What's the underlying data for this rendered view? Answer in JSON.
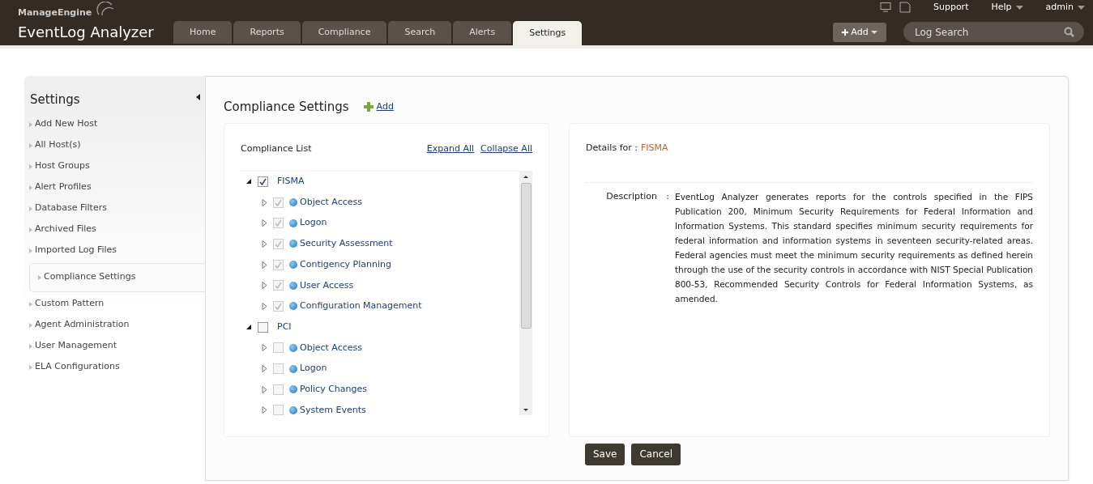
{
  "header": {
    "brand": "ManageEngine",
    "product": "EventLog Analyzer",
    "top_links": [
      {
        "label": "Support",
        "dropdown": false
      },
      {
        "label": "Help",
        "dropdown": true
      },
      {
        "label": "admin",
        "dropdown": true
      }
    ],
    "tabs": [
      {
        "label": "Home",
        "selected": false
      },
      {
        "label": "Reports",
        "selected": false
      },
      {
        "label": "Compliance",
        "selected": false
      },
      {
        "label": "Search",
        "selected": false
      },
      {
        "label": "Alerts",
        "selected": false
      },
      {
        "label": "Settings",
        "selected": true
      }
    ],
    "add_button": "Add",
    "search": {
      "placeholder": "Log Search"
    }
  },
  "sidebar": {
    "title": "Settings",
    "items": [
      {
        "label": "Add New Host",
        "selected": false
      },
      {
        "label": "All Host(s)",
        "selected": false
      },
      {
        "label": "Host Groups",
        "selected": false
      },
      {
        "label": "Alert Profiles",
        "selected": false
      },
      {
        "label": "Database Filters",
        "selected": false
      },
      {
        "label": "Archived Files",
        "selected": false
      },
      {
        "label": "Imported Log Files",
        "selected": false
      },
      {
        "label": "Compliance Settings",
        "selected": true
      },
      {
        "label": "Custom Pattern",
        "selected": false
      },
      {
        "label": "Agent Administration",
        "selected": false
      },
      {
        "label": "User Management",
        "selected": false
      },
      {
        "label": "ELA Configurations",
        "selected": false
      }
    ]
  },
  "content": {
    "title": "Compliance Settings",
    "add_link": "Add",
    "list": {
      "title": "Compliance List",
      "expand_all": "Expand All",
      "collapse_all": "Collapse All",
      "tree": [
        {
          "label": "FISMA",
          "expanded": true,
          "checked": true,
          "children": [
            {
              "label": "Object Access",
              "checked": true
            },
            {
              "label": "Logon",
              "checked": true
            },
            {
              "label": "Security Assessment",
              "checked": true
            },
            {
              "label": "Contigency Planning",
              "checked": true
            },
            {
              "label": "User Access",
              "checked": true
            },
            {
              "label": "Configuration Management",
              "checked": true
            }
          ]
        },
        {
          "label": "PCI",
          "expanded": true,
          "checked": false,
          "children": [
            {
              "label": "Object Access",
              "checked": false
            },
            {
              "label": "Logon",
              "checked": false
            },
            {
              "label": "Policy Changes",
              "checked": false
            },
            {
              "label": "System Events",
              "checked": false
            }
          ]
        }
      ]
    },
    "details": {
      "label": "Details for :",
      "name": "FISMA",
      "description_label": "Description",
      "separator": ":",
      "description": "EventLog Analyzer generates reports for the controls specified in the FIPS Publication 200, Minimum Security Requirements for Federal Information and Information Systems. This standard specifies minimum security requirements for federal information and information systems in seventeen security-related areas. Federal agencies must meet the minimum security requirements as defined herein through the use of the security controls in accordance with NIST Special Publication 800-53, Recommended Security Controls for Federal Information Systems, as amended."
    },
    "buttons": [
      "Save",
      "Cancel"
    ]
  }
}
